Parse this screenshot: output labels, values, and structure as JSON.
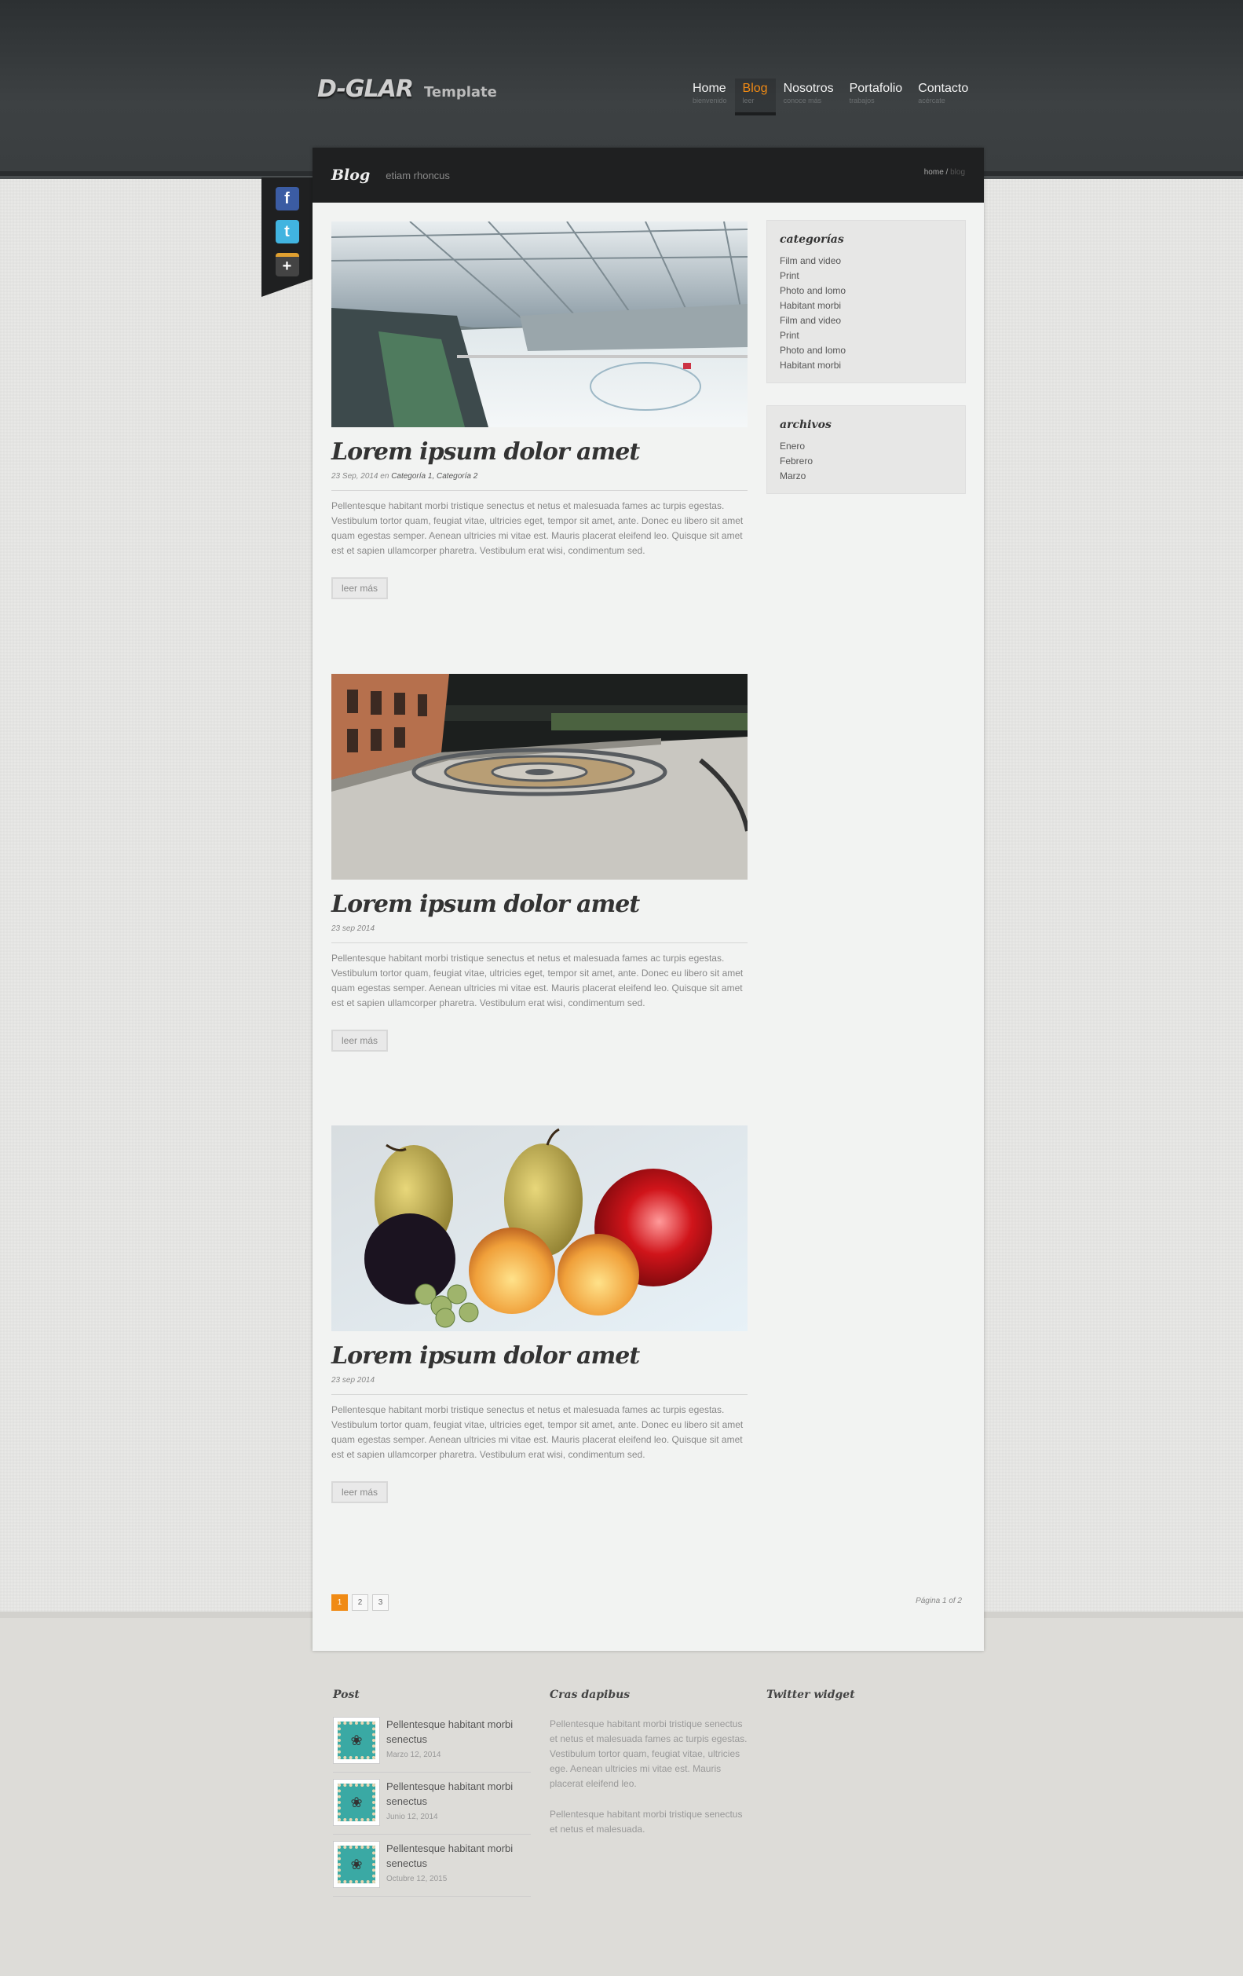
{
  "brand": {
    "logo": "D-GLAR",
    "tagline": "Template"
  },
  "nav": [
    {
      "label": "Home",
      "sub": "bienvenido"
    },
    {
      "label": "Blog",
      "sub": "leer"
    },
    {
      "label": "Nosotros",
      "sub": "conoce más"
    },
    {
      "label": "Portafolio",
      "sub": "trabajos"
    },
    {
      "label": "Contacto",
      "sub": "acércate"
    }
  ],
  "header": {
    "title": "Blog",
    "subtitle": "etiam rhoncus",
    "breadcrumb": {
      "home": "home",
      "separator": " / ",
      "current": "blog"
    }
  },
  "social": {
    "facebook": "f",
    "twitter": "t",
    "share": "+"
  },
  "posts": [
    {
      "image_icon": "ice-rink-photo",
      "title": "Lorem ipsum dolor amet",
      "date": "23 Sep, 2014 en",
      "cat1": "Categoría 1,",
      "cat2": "Categoría 2",
      "excerpt": "Pellentesque habitant morbi tristique senectus et netus et malesuada fames ac turpis egestas. Vestibulum tortor quam, feugiat vitae, ultricies eget, tempor sit amet, ante. Donec eu libero sit amet quam egestas semper. Aenean ultricies mi vitae est. Mauris placerat eleifend leo. Quisque sit amet est et sapien ullamcorper pharetra. Vestibulum erat wisi, condimentum sed.",
      "read_more": "leer más"
    },
    {
      "image_icon": "courtyard-photo",
      "title": "Lorem ipsum dolor amet",
      "date": "23 sep 2014",
      "excerpt": "Pellentesque habitant morbi tristique senectus et netus et malesuada fames ac turpis egestas. Vestibulum tortor quam, feugiat vitae, ultricies eget, tempor sit amet, ante. Donec eu libero sit amet quam egestas semper. Aenean ultricies mi vitae est. Mauris placerat eleifend leo. Quisque sit amet est et sapien ullamcorper pharetra. Vestibulum erat wisi, condimentum sed.",
      "read_more": "leer más"
    },
    {
      "image_icon": "fruit-painting-photo",
      "title": "Lorem ipsum dolor amet",
      "date": "23 sep 2014",
      "excerpt": "Pellentesque habitant morbi tristique senectus et netus et malesuada fames ac turpis egestas. Vestibulum tortor quam, feugiat vitae, ultricies eget, tempor sit amet, ante. Donec eu libero sit amet quam egestas semper. Aenean ultricies mi vitae est. Mauris placerat eleifend leo. Quisque sit amet est et sapien ullamcorper pharetra. Vestibulum erat wisi, condimentum sed.",
      "read_more": "leer más"
    }
  ],
  "sidebar": {
    "categories": {
      "title": "categorías",
      "items": [
        "Film and video",
        "Print",
        "Photo and lomo",
        "Habitant morbi",
        "Film and video",
        "Print",
        "Photo and lomo",
        "Habitant morbi"
      ]
    },
    "archives": {
      "title": "archivos",
      "items": [
        "Enero",
        "Febrero",
        "Marzo"
      ]
    }
  },
  "pagination": {
    "pages": [
      "1",
      "2",
      "3"
    ],
    "current": "1",
    "summary": "Página 1 of 2"
  },
  "footer": {
    "posts": {
      "title": "Post",
      "items": [
        {
          "title": "Pellentesque habitant morbi senectus",
          "date": "Marzo 12, 2014"
        },
        {
          "title": "Pellentesque habitant morbi senectus",
          "date": "Junio 12, 2014"
        },
        {
          "title": "Pellentesque habitant morbi senectus",
          "date": "Octubre 12, 2015"
        }
      ]
    },
    "cras": {
      "title": "Cras dapibus",
      "p1": "Pellentesque habitant morbi tristique senectus et netus et malesuada fames ac turpis egestas. Vestibulum tortor quam, feugiat vitae, ultricies ege. Aenean ultricies mi vitae est. Mauris placerat eleifend leo.",
      "p2": "Pellentesque habitant morbi tristique senectus et netus et malesuada."
    },
    "twitter": {
      "title": "Twitter widget"
    }
  },
  "colors": {
    "accent": "#f08a14",
    "header_dark": "#1f2021",
    "panel": "#f2f3f2"
  }
}
